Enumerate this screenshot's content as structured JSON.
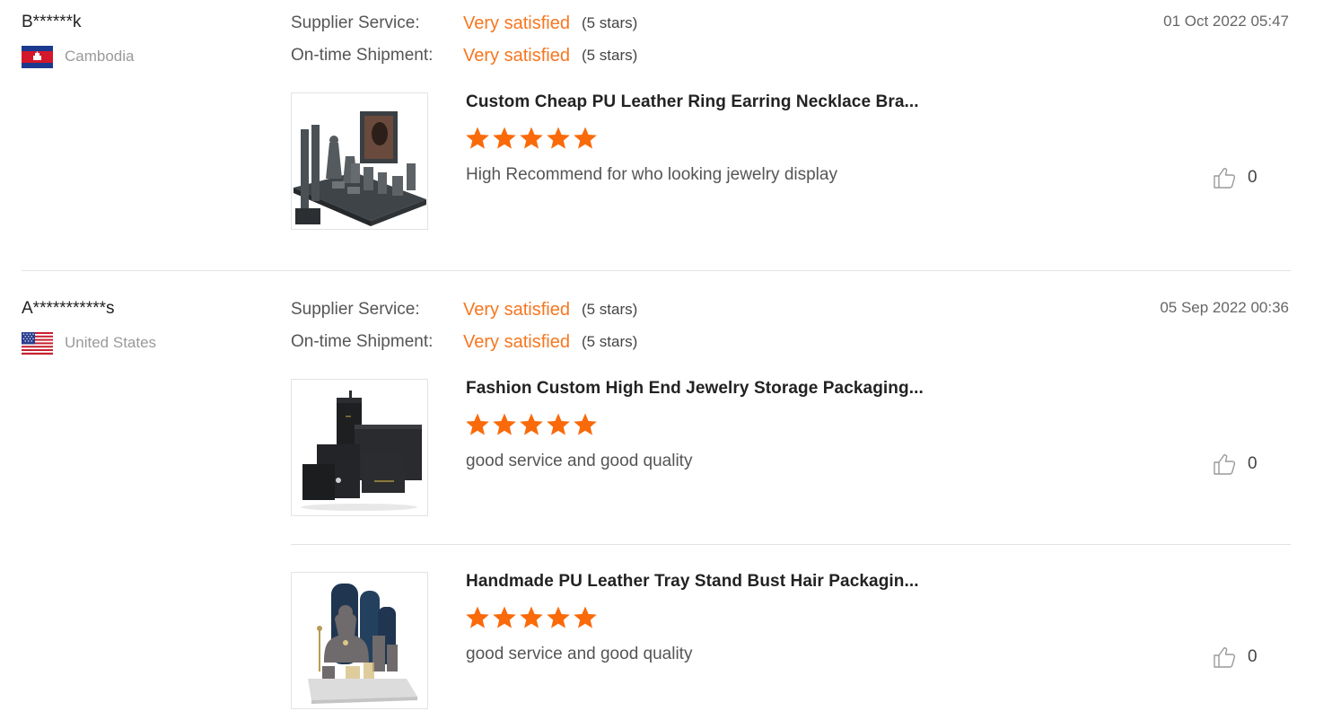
{
  "reviews": [
    {
      "user": "B******k",
      "country": "Cambodia",
      "flag_icon": "cambodia-flag-icon",
      "date": "01 Oct 2022 05:47",
      "supplier_service": {
        "label": "Supplier Service:",
        "value": "Very satisfied",
        "stars_text": "(5 stars)"
      },
      "shipment": {
        "label": "On-time Shipment:",
        "value": "Very satisfied",
        "stars_text": "(5 stars)"
      },
      "products": [
        {
          "title": "Custom Cheap PU Leather Ring Earring Necklace Bra...",
          "rating": 5,
          "comment": "High Recommend for who looking jewelry display",
          "likes": "0",
          "image_icon": "jewelry-display-set-image"
        }
      ]
    },
    {
      "user": "A***********s",
      "country": "United States",
      "flag_icon": "us-flag-icon",
      "date": "05 Sep 2022 00:36",
      "supplier_service": {
        "label": "Supplier Service:",
        "value": "Very satisfied",
        "stars_text": "(5 stars)"
      },
      "shipment": {
        "label": "On-time Shipment:",
        "value": "Very satisfied",
        "stars_text": "(5 stars)"
      },
      "products": [
        {
          "title": "Fashion Custom High End Jewelry Storage Packaging...",
          "rating": 5,
          "comment": "good service and good quality",
          "likes": "0",
          "image_icon": "jewelry-boxes-image"
        },
        {
          "title": "Handmade PU Leather Tray Stand Bust Hair Packagin...",
          "rating": 5,
          "comment": "good service and good quality",
          "likes": "0",
          "image_icon": "jewelry-bust-stand-image"
        }
      ]
    }
  ],
  "colors": {
    "accent_orange": "#f7761f",
    "star_orange": "#fa6a0a",
    "divider": "#e2e2e2"
  }
}
